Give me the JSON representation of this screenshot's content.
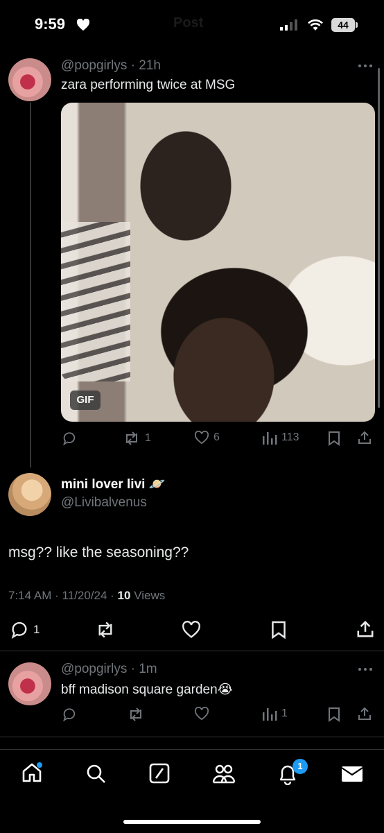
{
  "status_bar": {
    "time": "9:59",
    "battery": "44",
    "ghost_title": "Post"
  },
  "parent_post": {
    "handle": "@popgirlys",
    "time": "21h",
    "text": "zara performing twice at MSG",
    "media_badge": "GIF",
    "retweets": "1",
    "likes": "6",
    "views": "113"
  },
  "main_post": {
    "display_name": "mini lover livi",
    "name_emoji": "🪐",
    "handle": "@Livibalvenus",
    "text": "msg?? like the seasoning??",
    "time": "7:14 AM",
    "date": "11/20/24",
    "views_count": "10",
    "views_label": "Views",
    "replies": "1"
  },
  "reply_post": {
    "handle": "@popgirlys",
    "time": "1m",
    "text": "bff madison square garden",
    "emoji": "😭",
    "views": "1"
  },
  "tab_bar": {
    "notifications_badge": "1"
  }
}
